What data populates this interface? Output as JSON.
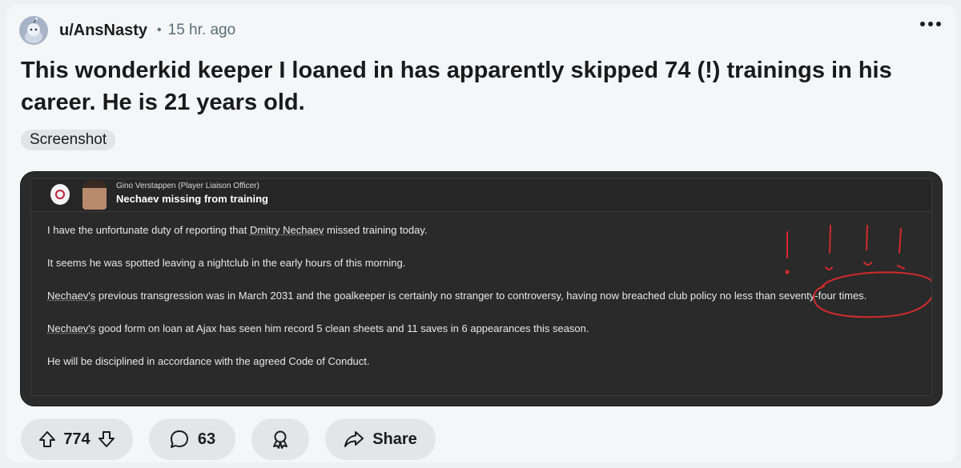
{
  "post": {
    "username": "u/AnsNasty",
    "separator": "•",
    "time": "15 hr. ago",
    "more_icon": "ellipsis-icon",
    "title": "This wonderkid keeper I loaned in has apparently skipped 74 (!) trainings in his career. He is 21 years old.",
    "flair": "Screenshot"
  },
  "screenshot": {
    "sender": "Gino Verstappen  (Player Liaison Officer)",
    "subject": "Nechaev missing from training",
    "lines": [
      {
        "pre": "I have the unfortunate duty of reporting that ",
        "u": "Dmitry Nechaev",
        "post": " missed training today."
      },
      {
        "pre": "",
        "u": "",
        "post": "It seems he was spotted leaving a nightclub in the early hours of this morning."
      },
      {
        "pre": "",
        "u": "Nechaev's",
        "post": " previous transgression was in March 2031 and the goalkeeper is certainly no stranger to controversy, having now breached club policy no less than seventy-four times."
      },
      {
        "pre": "",
        "u": "Nechaev's",
        "post": " good form on loan at Ajax has seen him record 5 clean sheets and 11 saves in 6 appearances this season."
      },
      {
        "pre": "",
        "u": "",
        "post": "He will be disciplined in accordance with the agreed Code of Conduct."
      }
    ],
    "annotation_color": "#d42a2a"
  },
  "actions": {
    "upvotes": "774",
    "comments": "63",
    "share_label": "Share"
  }
}
